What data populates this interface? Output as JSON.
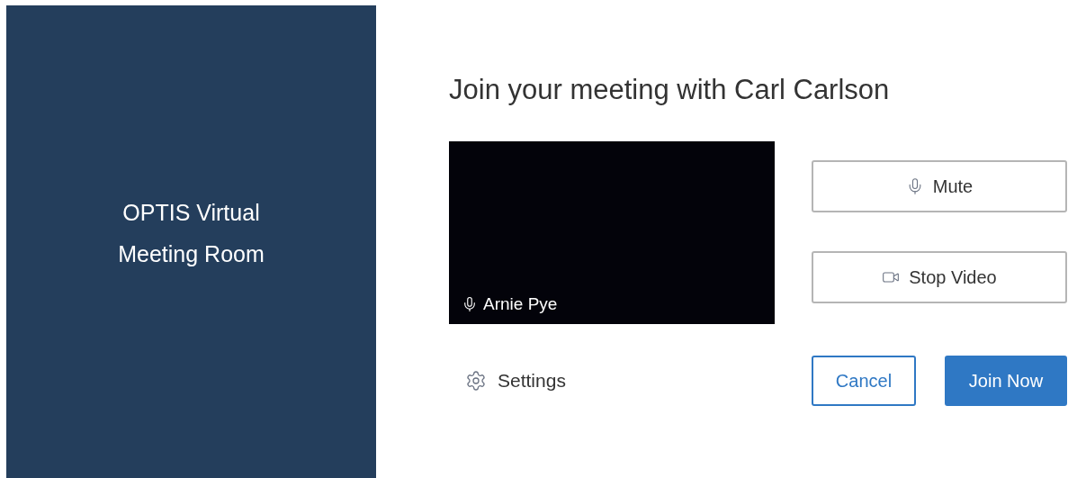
{
  "sidebar": {
    "title_lines": [
      "OPTIS Virtual",
      "Meeting Room"
    ]
  },
  "main": {
    "title": "Join your meeting with Carl Carlson",
    "preview": {
      "participant": "Arnie Pye"
    },
    "controls": [
      {
        "kind": "mic",
        "label": "Mute"
      },
      {
        "kind": "video",
        "label": "Stop Video"
      }
    ],
    "settings": {
      "label": "Settings"
    },
    "actions": [
      {
        "kind": "secondary",
        "label": "Cancel"
      },
      {
        "kind": "primary",
        "label": "Join Now"
      }
    ]
  }
}
